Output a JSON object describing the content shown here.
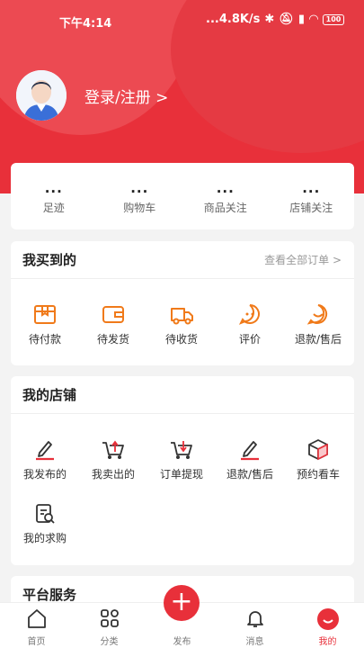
{
  "status": {
    "time": "下午4:14",
    "speed": "...4.8K/s",
    "battery": "100"
  },
  "profile": {
    "login": "登录/注册 >"
  },
  "quick": [
    {
      "dots": "...",
      "label": "足迹"
    },
    {
      "dots": "...",
      "label": "购物车"
    },
    {
      "dots": "...",
      "label": "商品关注"
    },
    {
      "dots": "...",
      "label": "店铺关注"
    }
  ],
  "bought": {
    "title": "我买到的",
    "more": "查看全部订单 >",
    "items": [
      {
        "label": "待付款",
        "icon": "box-icon"
      },
      {
        "label": "待发货",
        "icon": "wallet-icon"
      },
      {
        "label": "待收货",
        "icon": "truck-icon"
      },
      {
        "label": "评价",
        "icon": "comment-icon"
      },
      {
        "label": "退款/售后",
        "icon": "service-icon"
      }
    ]
  },
  "shop": {
    "title": "我的店铺",
    "items": [
      {
        "label": "我发布的",
        "icon": "pen-icon"
      },
      {
        "label": "我卖出的",
        "icon": "cart-up-icon"
      },
      {
        "label": "订单提现",
        "icon": "cart-down-icon"
      },
      {
        "label": "退款/售后",
        "icon": "pen-icon"
      },
      {
        "label": "预约看车",
        "icon": "cube-icon"
      }
    ],
    "row2": [
      {
        "label": "我的求购",
        "icon": "clipboard-search-icon"
      }
    ]
  },
  "platform": {
    "title": "平台服务"
  },
  "tabbar": {
    "tabs": [
      "首页",
      "分类",
      "发布",
      "消息",
      "我的"
    ],
    "publish_symbol": "+"
  },
  "colors": {
    "accent": "#e8303a",
    "orange": "#f07a1a"
  }
}
